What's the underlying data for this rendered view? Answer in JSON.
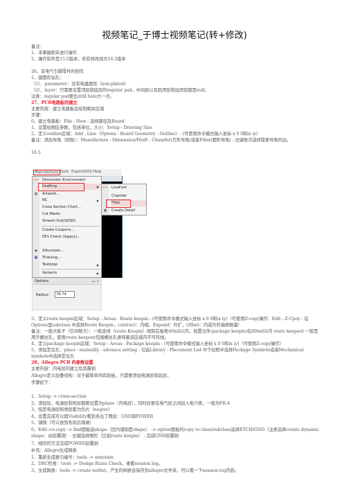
{
  "doc_title": "视频笔记_于博士视频笔记(转+修改)",
  "notes": {
    "header": "备注：",
    "items": [
      "1、未掌握即未进行操作",
      "2、操作软件是15.5版本，若有修改则为16.5版本"
    ]
  },
  "section26": {
    "title": "26、非电气引脚零件的制作",
    "lines": [
      "1、建圆形钻孔：",
      "（1）、parameter：没有电器属性（non-plated）",
      "（2）、layer：只需要设置顶层和底层的regular pad，中间层以及阻焊层和加焊层都是null。",
      "   注意：regular pad要比drill hole大一点。"
    ]
  },
  "section27": {
    "title": "27、PCB电路板的建立",
    "lines": [
      "主要内容：建立电路板及绘制相关区域",
      "步骤：",
      "0、建立电路板：File - New - 选择路径及Board",
      "1、设置绘图区参数，包括单位，大小：Setup - Drawing Size",
      "2、定义outline区域：Add - Line（Optons - Board Geometry - Outline）- (可使用命令模式输入坐标 x 0 0和ix iy)",
      "备注：添加导角（倒角）：Manufacture - Dimension/Draft - Chamfer(方形导角)或者Fillet(圆形导角) - 左键依次选择需要导角的边。",
      "16.5"
    ],
    "after_lines": [
      "3、定义route keepin区域：Setup - Areas - Route keepin - (可使用命令模式输入坐标 x 0 0和ix iy)（可使用Z-copy操作：Edit - Z-Cpoy - 在Options里subclass 中选择Route Keepin，contract：内缩，Expand：外扩，Offset：内或外的偏移数量）",
      "备注：一般大板子（空间够大）：一般走线（route Keepin）限制在板框40mil以内，放置元件(package keepin)在80mil以内 route keepout 一般是用于螺丝孔，使用route keepout包围螺丝孔意味着该区域内不可布线。",
      "4、定义package keepin区域：Setup - Areas - Package keepin - (可使用命令模式输入坐标 x 0 0和ix iy)（可使用Z-copy操作）",
      "5、添加定位孔：place - manually - advance setting - 勾选Library - Placement List 中下拉框中选择Package Symbols或者Mechanical symbols中选择定位孔"
    ]
  },
  "screenshot": {
    "menubar": [
      "Manufacture",
      "Tools",
      "ExportDOC",
      "Help"
    ],
    "menu_items": [
      {
        "label": "Dimension Environment",
        "icon": "dimension-icon",
        "arrow": false
      },
      {
        "label": "Drafting",
        "icon": "",
        "arrow": true
      },
      {
        "label": "Artwork...",
        "icon": "artwork-icon",
        "arrow": false
      },
      {
        "label": "NC",
        "icon": "",
        "arrow": true
      },
      {
        "label": "Cross Section Chart...",
        "icon": "",
        "arrow": false
      },
      {
        "label": "Cut Marks",
        "icon": "",
        "arrow": false
      },
      {
        "label": "Stream Out(GDSII)",
        "icon": "",
        "arrow": false
      },
      {
        "label": "Create Coupons...",
        "icon": "",
        "arrow": false
      },
      {
        "label": "DFx Check (legacy)...",
        "icon": "",
        "arrow": false
      },
      {
        "label": "Silkscreen...",
        "icon": "silkscreen-icon",
        "arrow": false
      },
      {
        "label": "Thieving...",
        "icon": "thieving-icon",
        "arrow": false
      },
      {
        "label": "Testprep",
        "icon": "",
        "arrow": true
      },
      {
        "label": "Variants",
        "icon": "",
        "arrow": true
      }
    ],
    "submenu_items": [
      "LineFont",
      "Chamfer",
      "Fillet",
      "Create Detail"
    ],
    "options_title": "Options",
    "radius_label": "Radius:",
    "radius_value": "78.74"
  },
  "section28": {
    "title": "28、Allegro PCB 的参数设置",
    "lines": [
      "主要内容：内电层的建立及其覆铜",
      "Allegro定义层叠结构：对于最简单的四层板，只需要添加电源层和底层，",
      "步骤如下：",
      "1、Setup -> cross-section",
      "2、添加层，电源层和地层都要设置为plane（内电层），同时还要在电气层之间加入电介质，一般为FR-4",
      "3、指定电源层和地层都为负片（negive）",
      "4、设置完成可以再Visibility看到多出了两层：GND和POWER",
      "5、铺铜（可以放到布局后再做）",
      "6、Edit->z-copy -> find面板选shape（因为铺铜是shape） -> option面板的copy to class/subclass选择ETCH/GND（注意选择create dynamic shape：动态覆铜）- 左键选择图形（比如route keepin） - 完成GND层覆铜",
      "7、相同的方法完成POWER层覆铜",
      "补充：Allegro生成网表",
      "1、重新生成索引编号：tools -> annotate",
      "2、DRC检查：tools -> Design Rules Check，查看session log。",
      "3、生成网表：tools -> create netlist，产生的网表会保存到allegro文件夹，可以看一下session log内容。"
    ]
  }
}
